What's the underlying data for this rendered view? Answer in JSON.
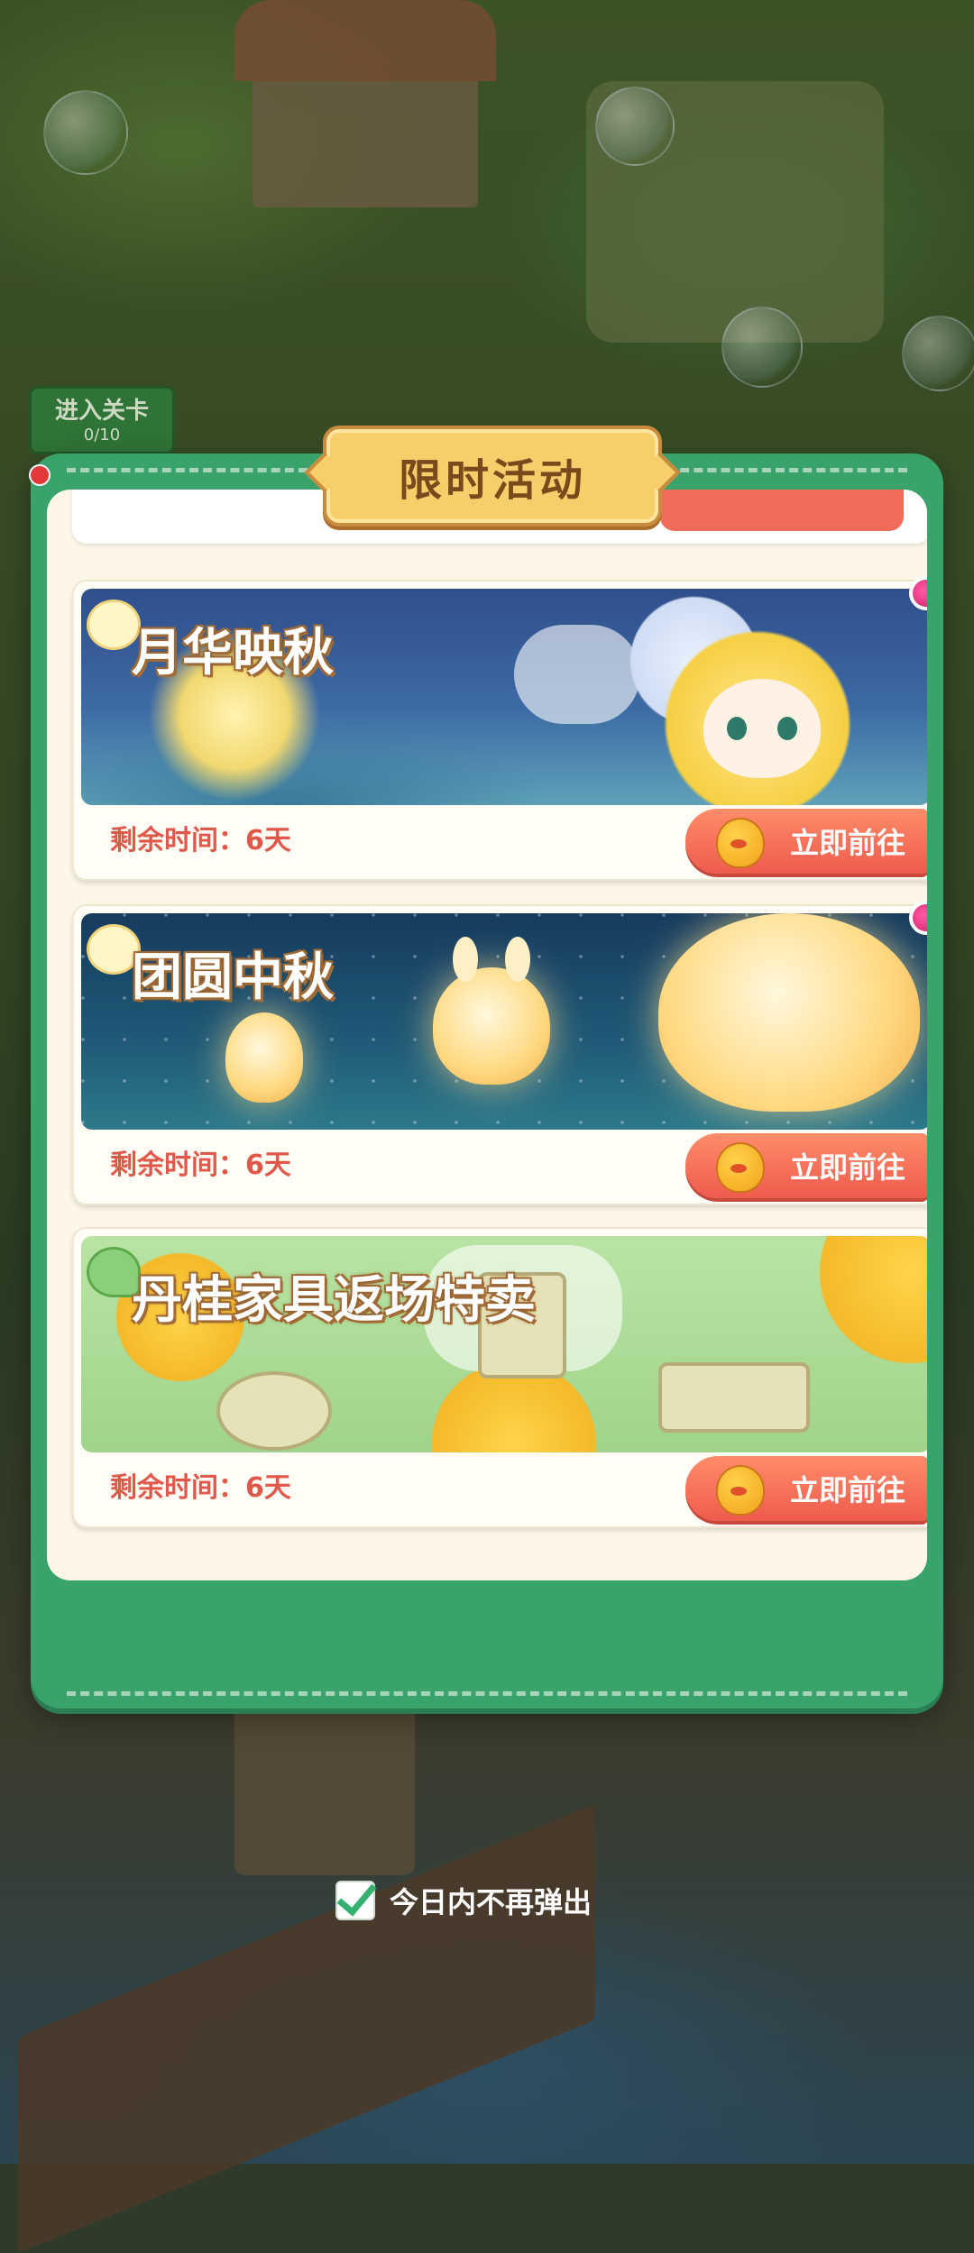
{
  "hud": {
    "enter_level_label": "进入关卡",
    "enter_level_progress": "0/10"
  },
  "panel": {
    "title": "限时活动"
  },
  "events": [
    {
      "title": "月华映秋",
      "remaining_label": "剩余时间：6天",
      "go_label": "立即前往",
      "has_new_badge": true
    },
    {
      "title": "团圆中秋",
      "remaining_label": "剩余时间：6天",
      "go_label": "立即前往",
      "has_new_badge": true
    },
    {
      "title": "丹桂家具返场特卖",
      "remaining_label": "剩余时间：6天",
      "go_label": "立即前往",
      "has_new_badge": false
    }
  ],
  "dont_show_today": {
    "label": "今日内不再弹出",
    "checked": true
  }
}
